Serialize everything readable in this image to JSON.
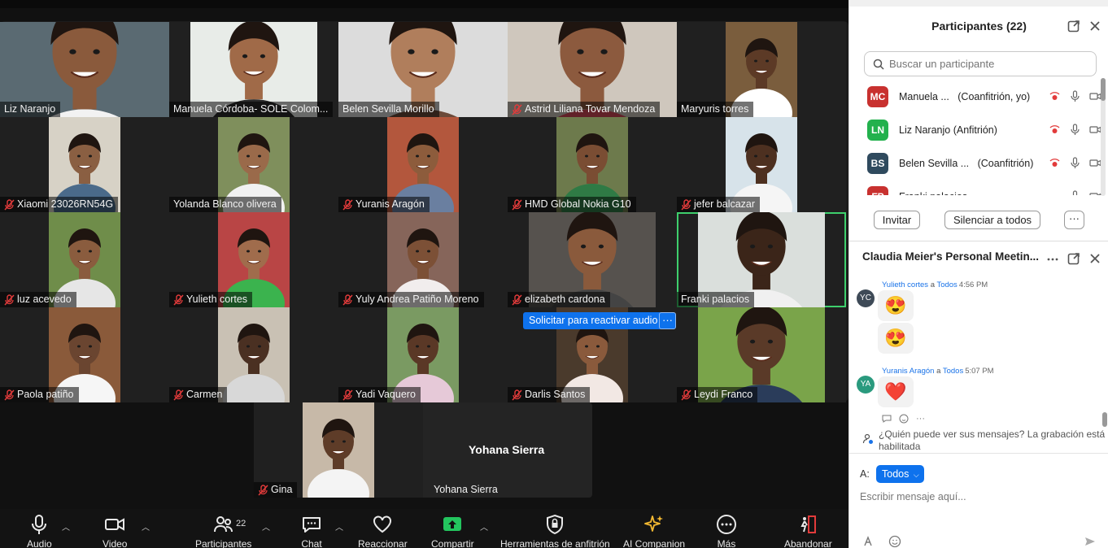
{
  "participants_panel": {
    "title": "Participantes (22)",
    "search_placeholder": "Buscar un participante",
    "list": [
      {
        "initials": "MC",
        "name": "Manuela ...",
        "role": "(Coanfitrión, yo)",
        "color": "#c8312f"
      },
      {
        "initials": "LN",
        "name": "Liz Naranjo (Anfitrión)",
        "role": "",
        "color": "#23b14d"
      },
      {
        "initials": "BS",
        "name": "Belen Sevilla ...",
        "role": "(Coanfitrión)",
        "color": "#2f4a5e"
      },
      {
        "initials": "FP",
        "name": "Franki  palacios",
        "role": "",
        "color": "#c8312f"
      }
    ],
    "invite_label": "Invitar",
    "mute_all_label": "Silenciar a todos",
    "more_label": "···"
  },
  "chat_panel": {
    "title": "Claudia Meier's Personal Meetin...",
    "messages": [
      {
        "avatar": "YC",
        "avatar_color": "#3e4a57",
        "sender": "Yulieth cortes",
        "to_word": "a",
        "to": "Todos",
        "time": "4:56 PM",
        "emojis": [
          "😍",
          "😍"
        ]
      },
      {
        "avatar": "YA",
        "avatar_color": "#2a9a7e",
        "sender": "Yuranis Aragón",
        "to_word": "a",
        "to": "Todos",
        "time": "5:07 PM",
        "emojis": [
          "❤️"
        ]
      }
    ],
    "who_sees": "¿Quién puede ver sus mensajes? La grabación está habilitada",
    "to_label": "A:",
    "to_value": "Todos",
    "input_placeholder": "Escribir mensaje aquí..."
  },
  "tiles": [
    {
      "name": "Liz Naranjo",
      "muted": false
    },
    {
      "name": "Manuela Córdoba- SOLE Colom...",
      "muted": false
    },
    {
      "name": "Belen Sevilla Morillo",
      "muted": false
    },
    {
      "name": "Astrid Liliana Tovar Mendoza",
      "muted": true
    },
    {
      "name": "Maryuris torres",
      "muted": false
    },
    {
      "name": "Xiaomi 23026RN54G",
      "muted": true
    },
    {
      "name": "Yolanda Blanco olivera",
      "muted": false
    },
    {
      "name": "Yuranis Aragón",
      "muted": true
    },
    {
      "name": "HMD Global Nokia G10",
      "muted": true
    },
    {
      "name": "jefer balcazar",
      "muted": true
    },
    {
      "name": "luz acevedo",
      "muted": true
    },
    {
      "name": "Yulieth cortes",
      "muted": true
    },
    {
      "name": "Yuly Andrea Patiño Moreno",
      "muted": true
    },
    {
      "name": "elizabeth cardona",
      "muted": true
    },
    {
      "name": "Franki  palacios",
      "muted": false
    },
    {
      "name": "Paola patiño",
      "muted": true
    },
    {
      "name": "Carmen",
      "muted": true
    },
    {
      "name": "Yadi Vaquero",
      "muted": true
    },
    {
      "name": "Darlis Santos",
      "muted": true
    },
    {
      "name": "Leydi Franco",
      "muted": true
    },
    {
      "name": "Gina",
      "muted": true
    },
    {
      "name": "Yohana Sierra",
      "muted": false
    }
  ],
  "big_name": "Yohana Sierra",
  "unmute_request": {
    "label": "Solicitar para reactivar audio",
    "more": "···"
  },
  "toolbar": {
    "audio": "Audio",
    "video": "Video",
    "participants": "Participantes",
    "participants_count": "22",
    "chat": "Chat",
    "react": "Reaccionar",
    "share": "Compartir",
    "host_tools": "Herramientas de anfitrión",
    "ai": "AI Companion",
    "more": "Más",
    "leave": "Abandonar"
  }
}
